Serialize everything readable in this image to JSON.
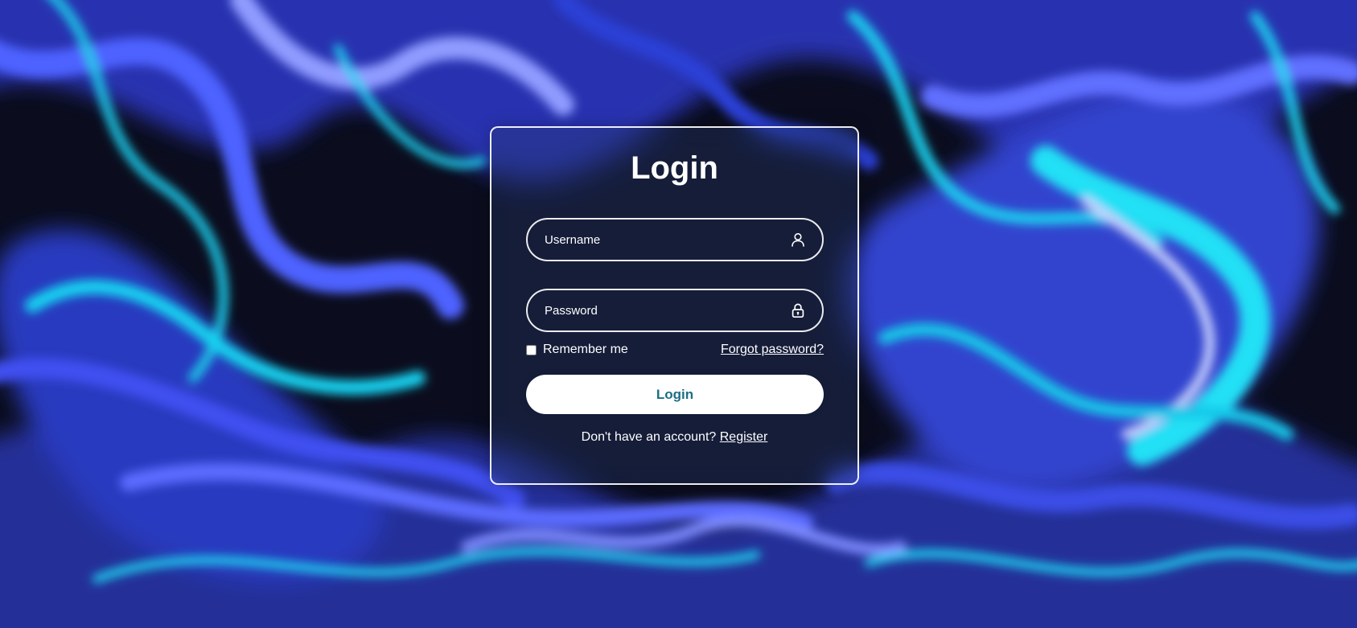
{
  "colors": {
    "background_dark": "#0b0d1e",
    "swirl_blue": "#3a4de6",
    "swirl_violet": "#5b6cff",
    "swirl_cyan": "#1fd3f0",
    "swirl_teal": "#1a8fa0",
    "button_text": "#1b6f86",
    "border_white": "#ffffff"
  },
  "login": {
    "title": "Login",
    "username": {
      "placeholder": "Username",
      "value": "",
      "icon": "user-icon"
    },
    "password": {
      "placeholder": "Password",
      "value": "",
      "icon": "lock-icon"
    },
    "remember_label": "Remember me",
    "remember_checked": false,
    "forgot_label": "Forgot password?",
    "submit_label": "Login",
    "register_prompt": "Don't have an account?",
    "register_label": "Register"
  }
}
